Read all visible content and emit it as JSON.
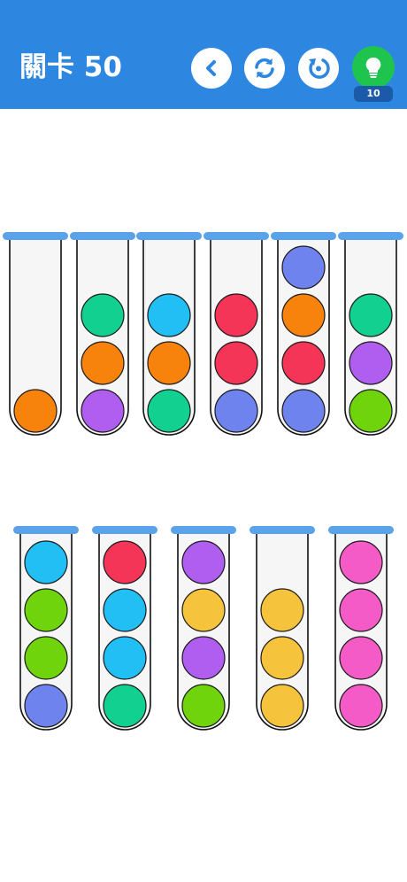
{
  "header": {
    "level_title": "關卡 50",
    "hint_count": "10",
    "colors": {
      "bar": "#2d86e0",
      "button_icon": "#2d86e0",
      "hint": "#1fc44f"
    }
  },
  "buttons": [
    {
      "name": "back-button",
      "icon": "chevron-left-icon"
    },
    {
      "name": "shuffle-button",
      "icon": "refresh-arrows-icon"
    },
    {
      "name": "restart-button",
      "icon": "restart-icon"
    },
    {
      "name": "hint-button",
      "icon": "lightbulb-icon"
    }
  ],
  "palette": {
    "orange": "#f7820c",
    "teal": "#12d08f",
    "purple": "#b05ef0",
    "sky": "#22bff4",
    "red": "#f43557",
    "periwinkle": "#6f83ef",
    "lime": "#6fd40b",
    "yellow": "#f6c33d",
    "pink": "#f45bc6"
  },
  "tubes": [
    {
      "row": 1,
      "balls_bottom_to_top": [
        "orange"
      ]
    },
    {
      "row": 1,
      "balls_bottom_to_top": [
        "purple",
        "orange",
        "teal"
      ]
    },
    {
      "row": 1,
      "balls_bottom_to_top": [
        "teal",
        "orange",
        "sky"
      ]
    },
    {
      "row": 1,
      "balls_bottom_to_top": [
        "periwinkle",
        "red",
        "red"
      ]
    },
    {
      "row": 1,
      "balls_bottom_to_top": [
        "periwinkle",
        "red",
        "orange",
        "periwinkle"
      ]
    },
    {
      "row": 1,
      "balls_bottom_to_top": [
        "lime",
        "purple",
        "teal"
      ]
    },
    {
      "row": 2,
      "balls_bottom_to_top": [
        "periwinkle",
        "lime",
        "lime",
        "sky"
      ]
    },
    {
      "row": 2,
      "balls_bottom_to_top": [
        "teal",
        "sky",
        "sky",
        "red"
      ]
    },
    {
      "row": 2,
      "balls_bottom_to_top": [
        "lime",
        "purple",
        "yellow",
        "purple"
      ]
    },
    {
      "row": 2,
      "balls_bottom_to_top": [
        "yellow",
        "yellow",
        "yellow"
      ]
    },
    {
      "row": 2,
      "balls_bottom_to_top": [
        "pink",
        "pink",
        "pink",
        "pink"
      ]
    }
  ]
}
